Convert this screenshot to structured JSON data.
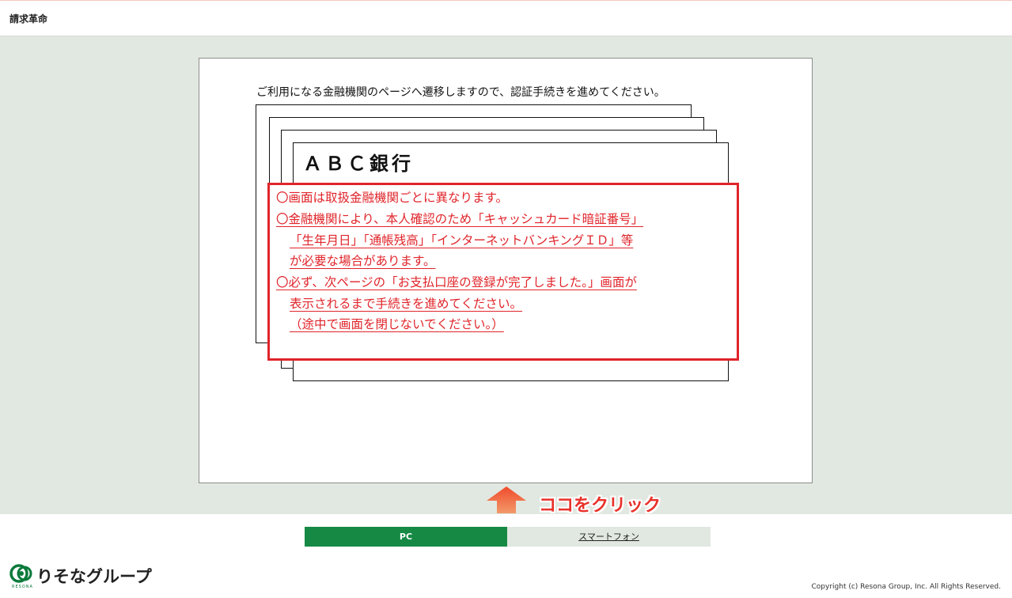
{
  "header": {
    "title": "請求革命"
  },
  "panel": {
    "intro": "ご利用になる金融機関のページへ遷移しますので、認証手続きを進めてください。",
    "bank_name": "ＡＢＣ銀行",
    "notice_lines": [
      "〇画面は取扱金融機関ごとに異なります。",
      "〇金融機関により、本人確認のため「キャッシュカード暗証番号」",
      "「生年月日」「通帳残高」「インターネットバンキングＩＤ」等",
      "が必要な場合があります。",
      "〇必ず、次ページの「お支払口座の登録が完了しました。」画面が",
      "表示されるまで手続きを進めてください。",
      "（途中で画面を閉じないでください。）"
    ],
    "notice_color": "#e0242a"
  },
  "callout": {
    "label": "ココをクリック",
    "arrow_icon": "up-arrow-icon",
    "color": "#e8322a"
  },
  "tabs": [
    {
      "label": "PC",
      "active": true,
      "color": "#168a44"
    },
    {
      "label": "スマートフォン",
      "active": false
    }
  ],
  "footer": {
    "logo_text": "りそなグループ",
    "logo_sub": "RESONA",
    "copyright": "Copyright (c) Resona Group, Inc. All Rights Reserved."
  }
}
